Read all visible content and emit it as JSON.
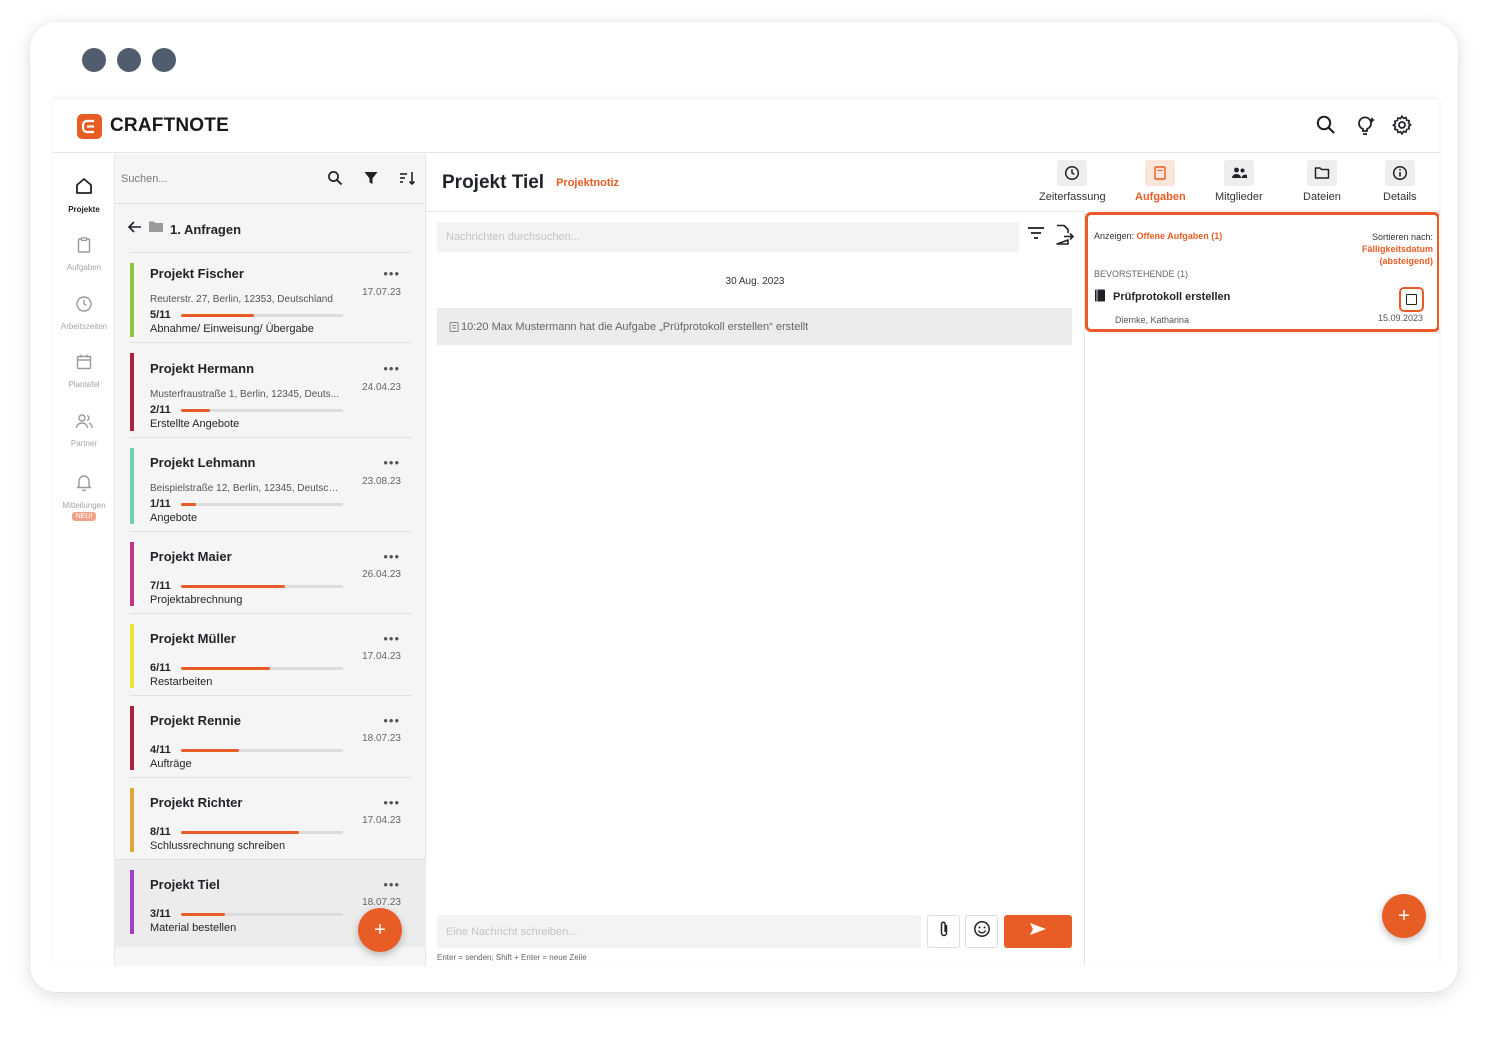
{
  "app": {
    "name": "CRAFTNOTE"
  },
  "colors": {
    "accent": "#e85d26"
  },
  "nav": [
    {
      "label": "Projekte",
      "icon": "home-icon",
      "active": true
    },
    {
      "label": "Aufgaben",
      "icon": "clipboard-icon"
    },
    {
      "label": "Arbeitszeiten",
      "icon": "clock-icon"
    },
    {
      "label": "Plantafel",
      "icon": "calendar-icon"
    },
    {
      "label": "Partner",
      "icon": "users-icon"
    },
    {
      "label": "Mitteilungen",
      "icon": "bell-icon",
      "badge": "NEU!"
    }
  ],
  "project_list": {
    "search_placeholder": "Suchen...",
    "folder": "1. Anfragen",
    "more": "•••",
    "items": [
      {
        "name": "Projekt Fischer",
        "address": "Reuterstr. 27, Berlin, 12353, Deutschland",
        "date": "17.07.23",
        "count": "5/11",
        "progress": 0.45,
        "phase": "Abnahme/ Einweisung/ Übergabe",
        "color": "#8cc63f"
      },
      {
        "name": "Projekt Hermann",
        "address": "Musterfraustraße 1, Berlin, 12345, Deuts...",
        "date": "24.04.23",
        "count": "2/11",
        "progress": 0.18,
        "phase": "Erstellte Angebote",
        "color": "#a8243a"
      },
      {
        "name": "Projekt Lehmann",
        "address": "Beispielstraße 12, Berlin, 12345, Deutsch...",
        "date": "23.08.23",
        "count": "1/11",
        "progress": 0.09,
        "phase": "Angebote",
        "color": "#6fcfae"
      },
      {
        "name": "Projekt Maier",
        "address": "",
        "date": "26.04.23",
        "count": "7/11",
        "progress": 0.64,
        "phase": "Projektabrechnung",
        "color": "#c2368a"
      },
      {
        "name": "Projekt Müller",
        "address": "",
        "date": "17.04.23",
        "count": "6/11",
        "progress": 0.55,
        "phase": "Restarbeiten",
        "color": "#f2e33a"
      },
      {
        "name": "Projekt Rennie",
        "address": "",
        "date": "18.07.23",
        "count": "4/11",
        "progress": 0.36,
        "phase": "Aufträge",
        "color": "#a8243a"
      },
      {
        "name": "Projekt Richter",
        "address": "",
        "date": "17.04.23",
        "count": "8/11",
        "progress": 0.73,
        "phase": "Schlussrechnung schreiben",
        "color": "#e2a63c"
      },
      {
        "name": "Projekt Tiel",
        "address": "",
        "date": "18.07.23",
        "count": "3/11",
        "progress": 0.27,
        "phase": "Material bestellen",
        "color": "#a23ec9",
        "selected": true
      }
    ]
  },
  "chat": {
    "title": "Projekt Tiel",
    "subtitle": "Projektnotiz",
    "search_placeholder": "Nachrichten durchsuchen...",
    "day": "30 Aug. 2023",
    "system_message": "10:20 Max Mustermann hat die Aufgabe „Prüfprotokoll erstellen“ erstellt",
    "compose_placeholder": "Eine Nachricht schreiben...",
    "hint": "Enter = senden; Shift + Enter = neue Zeile"
  },
  "tabs": [
    {
      "label": "Zeiterfassung",
      "icon": "clock-icon"
    },
    {
      "label": "Aufgaben",
      "icon": "clipboard-icon",
      "active": true
    },
    {
      "label": "Mitglieder",
      "icon": "members-icon"
    },
    {
      "label": "Dateien",
      "icon": "folder-icon"
    },
    {
      "label": "Details",
      "icon": "info-icon"
    }
  ],
  "tasks": {
    "show_label": "Anzeigen:",
    "show_value": "Offene Aufgaben (1)",
    "sort_label": "Sortieren nach:",
    "sort_value_1": "Fälligkeitsdatum",
    "sort_value_2": "(absteigend)",
    "section": "BEVORSTEHENDE (1)",
    "task_title": "Prüfprotokoll erstellen",
    "assignee": "Diemke, Katharina",
    "due": "15.09.2023"
  },
  "fab_label": "+"
}
